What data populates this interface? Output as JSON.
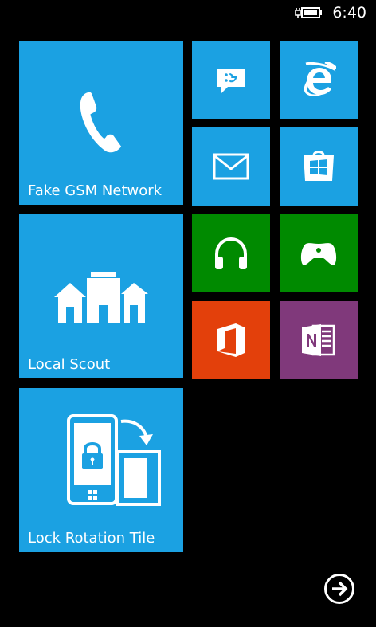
{
  "status_bar": {
    "time": "6:40",
    "battery_icon": "battery-charging-icon"
  },
  "colors": {
    "accent": "#1BA1E2",
    "green": "#008A00",
    "orange": "#E3400B",
    "purple": "#80397B",
    "background": "#000000"
  },
  "tiles": {
    "phone": {
      "label": "Fake GSM Network",
      "icon": "phone-icon"
    },
    "messaging": {
      "icon": "messaging-icon"
    },
    "internet_explorer": {
      "icon": "internet-explorer-icon"
    },
    "mail": {
      "icon": "mail-icon"
    },
    "store": {
      "icon": "store-icon"
    },
    "music": {
      "icon": "headphones-icon"
    },
    "games": {
      "icon": "game-controller-icon"
    },
    "office": {
      "icon": "office-icon"
    },
    "onenote": {
      "icon": "onenote-icon"
    },
    "local_scout": {
      "label": "Local Scout",
      "icon": "buildings-icon"
    },
    "lock_rotation": {
      "label": "Lock Rotation Tile",
      "icon": "lock-rotation-icon"
    }
  },
  "app_list_button": {
    "icon": "arrow-right-circle-icon"
  }
}
